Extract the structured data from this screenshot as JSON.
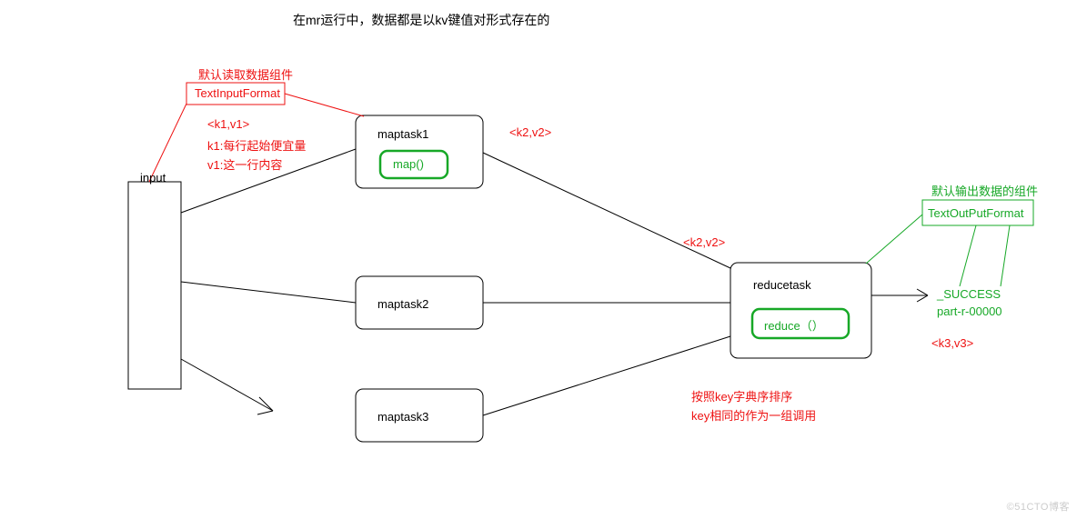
{
  "title": "在mr运行中，数据都是以kv键值对形式存在的",
  "input_label": "input",
  "input_reader": {
    "note": "默认读取数据组件",
    "name": "TextInputFormat"
  },
  "k1v1": {
    "pair": "<k1,v1>",
    "k1": "k1:每行起始便宜量",
    "v1": "v1:这一行内容"
  },
  "map": {
    "box1": "maptask1",
    "box2": "maptask2",
    "box3": "maptask3",
    "fn": "map()"
  },
  "k2v2_top": "<k2,v2>",
  "k2v2_mid": "<k2,v2>",
  "reduce": {
    "name": "reducetask",
    "fn": "reduce（）",
    "sort1": "按照key字典序排序",
    "sort2": "key相同的作为一组调用"
  },
  "output_writer": {
    "note": "默认输出数据的组件",
    "name": "TextOutPutFormat"
  },
  "outputs": {
    "success": "_SUCCESS",
    "part": "part-r-00000"
  },
  "k3v3": "<k3,v3>",
  "watermark": "©51CTO博客"
}
